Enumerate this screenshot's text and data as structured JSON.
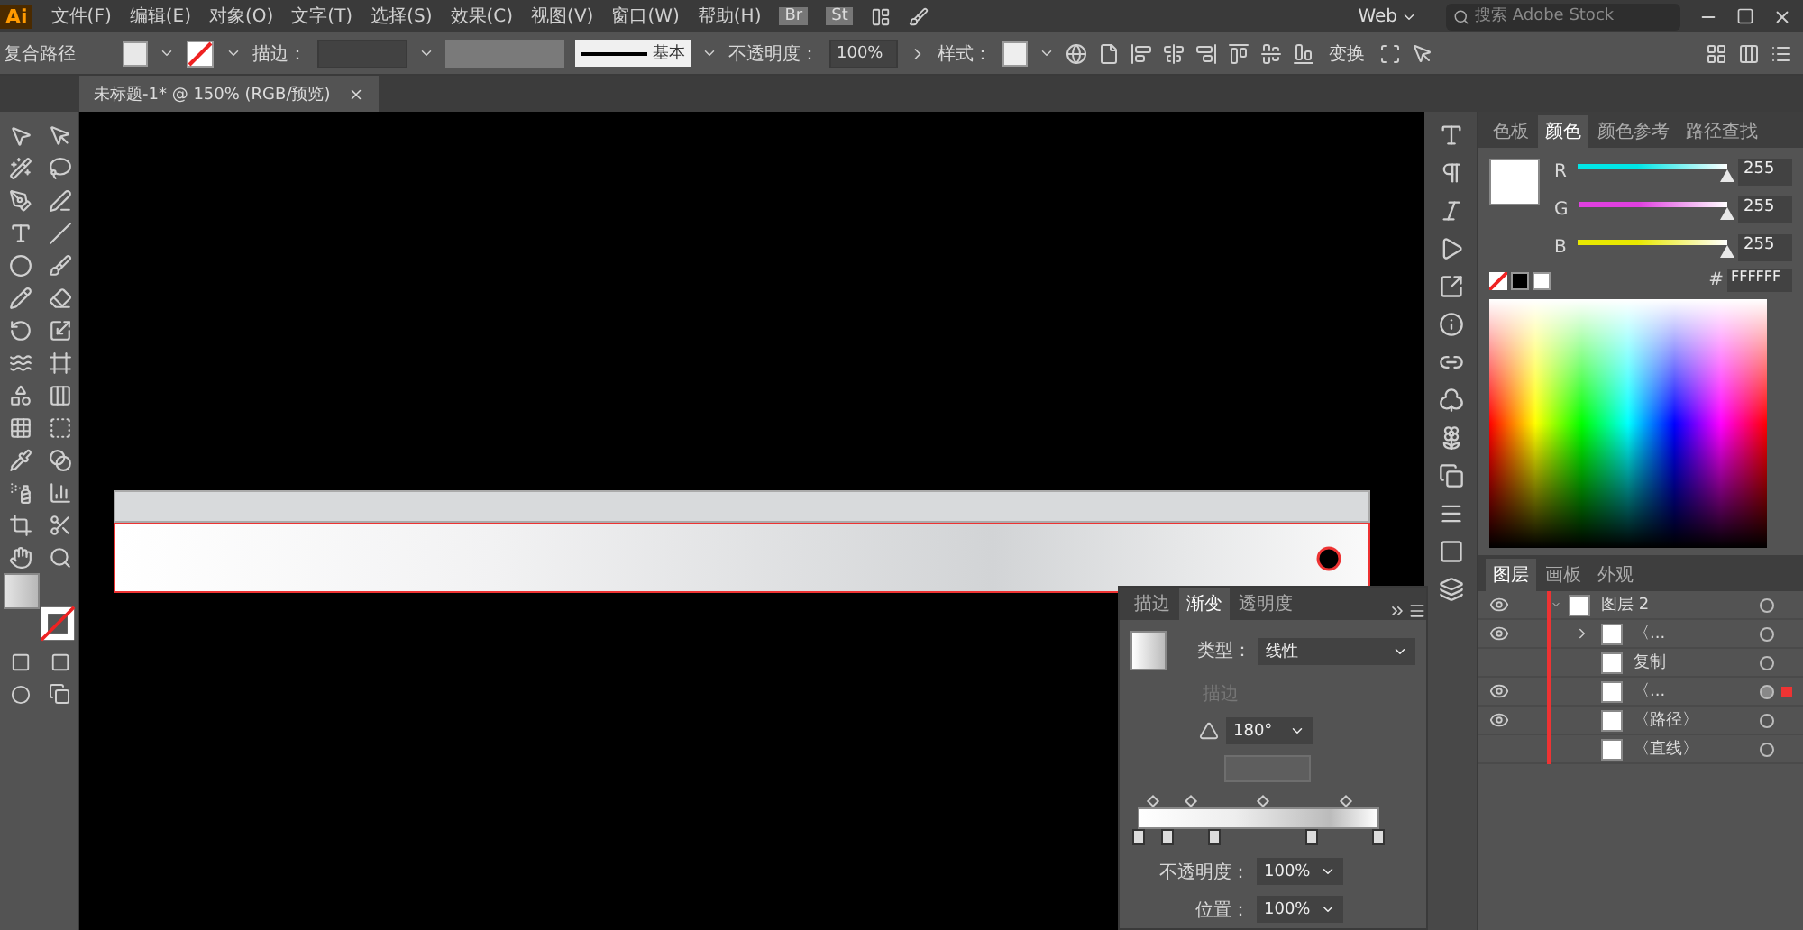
{
  "menu_bar": {
    "logo": "Ai",
    "items": [
      "文件(F)",
      "编辑(E)",
      "对象(O)",
      "文字(T)",
      "选择(S)",
      "效果(C)",
      "视图(V)",
      "窗口(W)",
      "帮助(H)"
    ],
    "bridge": "Br",
    "stock": "St",
    "workspace": "Web",
    "search": {
      "placeholder": "搜索 Adobe Stock"
    }
  },
  "control_bar": {
    "selection": "复合路径",
    "stroke_label": "描边：",
    "stroke_profile": "基本",
    "opacity_label": "不透明度：",
    "opacity": "100%",
    "style_label": "样式：",
    "transform": "变换"
  },
  "document_tabs": [
    {
      "title": "未标题-1* @ 150% (RGB/预览)",
      "selected": true
    }
  ],
  "color_panel": {
    "tabs": [
      {
        "label": "色板",
        "selected": false
      },
      {
        "label": "颜色",
        "selected": true
      },
      {
        "label": "颜色参考",
        "selected": false
      },
      {
        "label": "路径查找",
        "selected": false
      }
    ],
    "channels": [
      {
        "name": "R",
        "value": "255",
        "level": 1,
        "color": "#00e5e5"
      },
      {
        "name": "G",
        "value": "255",
        "level": 1,
        "color": "#e040e0"
      },
      {
        "name": "B",
        "value": "255",
        "level": 1,
        "color": "#e8e800"
      }
    ],
    "hex_label": "#",
    "hex": "FFFFFF"
  },
  "layers_panel": {
    "tabs": [
      {
        "label": "图层",
        "selected": true
      },
      {
        "label": "画板",
        "selected": false
      },
      {
        "label": "外观",
        "selected": false
      }
    ],
    "layers": [
      {
        "name": "图层 2",
        "visible": true,
        "selected": false,
        "expanded": true,
        "children": [
          {
            "name": "〈...",
            "visible": true,
            "selected": false,
            "expanded": false
          },
          {
            "name": "复制",
            "visible": false,
            "selected": false
          },
          {
            "name": "〈...",
            "visible": true,
            "selected": true
          },
          {
            "name": "〈路径〉",
            "visible": true,
            "selected": false
          },
          {
            "name": "〈直线〉",
            "visible": false,
            "selected": false
          }
        ]
      }
    ]
  },
  "gradient_panel": {
    "tabs": [
      {
        "label": "描边",
        "selected": false
      },
      {
        "label": "渐变",
        "selected": true
      },
      {
        "label": "透明度",
        "selected": false
      }
    ],
    "type_label": "类型：",
    "type": "线性",
    "stroke_label": "描边",
    "angle": "180°",
    "stops": [
      {
        "level": 0
      },
      {
        "level": 0.12
      },
      {
        "level": 0.31
      },
      {
        "level": 0.72
      },
      {
        "level": 0.99
      }
    ],
    "opacity_label": "不透明度：",
    "opacity": "100%",
    "location_label": "位置：",
    "location": "100%"
  }
}
